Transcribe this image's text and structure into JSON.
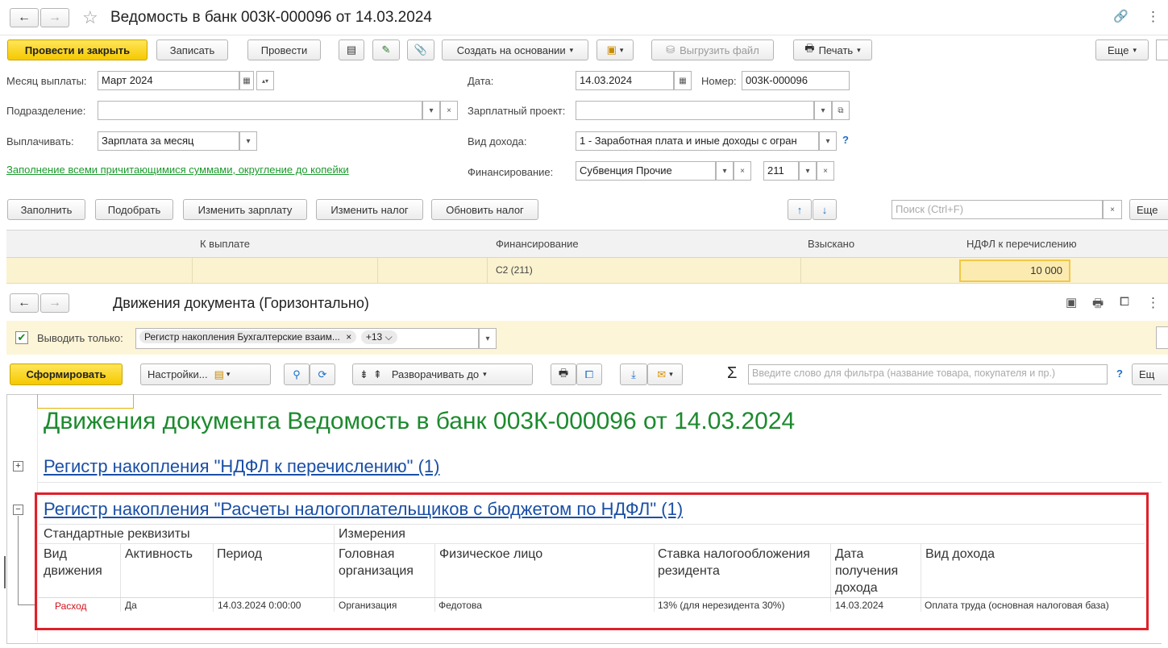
{
  "window": {
    "title": "Ведомость в банк 003К-000096 от 14.03.2024",
    "link_glyph": "🔗",
    "more_glyph": "⋮"
  },
  "toolbar": {
    "post_close": "Провести и закрыть",
    "save": "Записать",
    "post": "Провести",
    "create_based": "Создать на основании",
    "export_file": "Выгрузить файл",
    "print": "Печать",
    "more": "Еще"
  },
  "form": {
    "month_label": "Месяц выплаты:",
    "month_value": "Март 2024",
    "date_label": "Дата:",
    "date_value": "14.03.2024",
    "number_label": "Номер:",
    "number_value": "003К-000096",
    "subdivision_label": "Подразделение:",
    "subdivision_value": "",
    "salary_project_label": "Зарплатный проект:",
    "salary_project_value": "",
    "pay_label": "Выплачивать:",
    "pay_value": "Зарплата за месяц",
    "income_type_label": "Вид дохода:",
    "income_type_value": "1 - Заработная плата и иные доходы с огран",
    "help": "?",
    "fill_link": "Заполнение всеми причитающимися суммами, округление до копейки",
    "financing_label": "Финансирование:",
    "financing_value": "Субвенция Прочие",
    "financing_code": "211"
  },
  "table_toolbar": {
    "fill": "Заполнить",
    "pick": "Подобрать",
    "change_salary": "Изменить зарплату",
    "change_tax": "Изменить налог",
    "update_tax": "Обновить налог",
    "search_placeholder": "Поиск (Ctrl+F)",
    "more": "Еще"
  },
  "grid": {
    "columns": [
      "К выплате",
      "Финансирование",
      "Взыскано",
      "НДФЛ к перечислению"
    ],
    "row": {
      "payout": "",
      "financing": "С2 (211)",
      "collected": "",
      "ndfl": "10 000"
    }
  },
  "report": {
    "title": "Движения документа (Горизонтально)",
    "filter_label": "Выводить только:",
    "filter_value": "Регистр накопления Бухгалтерские взаим...",
    "filter_more": "+13",
    "generate": "Сформировать",
    "settings": "Настройки...",
    "expand": "Разворачивать до",
    "sigma": "Σ",
    "filter_placeholder": "Введите слово для фильтра (название товара, покупателя и пр.)",
    "help": "?",
    "more": "Ещ",
    "heading": "Движения документа Ведомость в банк 003К-000096 от 14.03.2024",
    "register1": "Регистр накопления \"НДФЛ к перечислению\" (1)",
    "register2": "Регистр накопления \"Расчеты налогоплательщиков с бюджетом по НДФЛ\" (1)",
    "group_standard": "Стандартные реквизиты",
    "group_dimensions": "Измерения",
    "col_kind": "Вид движения",
    "col_active": "Активность",
    "col_period": "Период",
    "col_org": "Головная организация",
    "col_person": "Физическое лицо",
    "col_rate": "Ставка налогообложения резидента",
    "col_date": "Дата получения дохода",
    "col_income": "Вид дохода",
    "row": {
      "kind": "Расход",
      "active": "Да",
      "period": "14.03.2024 0:00:00",
      "org": "Организация",
      "person": "Федотова",
      "rate": "13% (для нерезидента 30%)",
      "date": "14.03.2024",
      "income": "Оплата труда (основная налоговая база)"
    }
  },
  "colors": {
    "accent_yellow": "#f5c900",
    "heading_green": "#1c8a2e",
    "link_blue": "#1a4fa6",
    "highlight_red": "#e0202a",
    "expense_red": "#d0121b"
  }
}
